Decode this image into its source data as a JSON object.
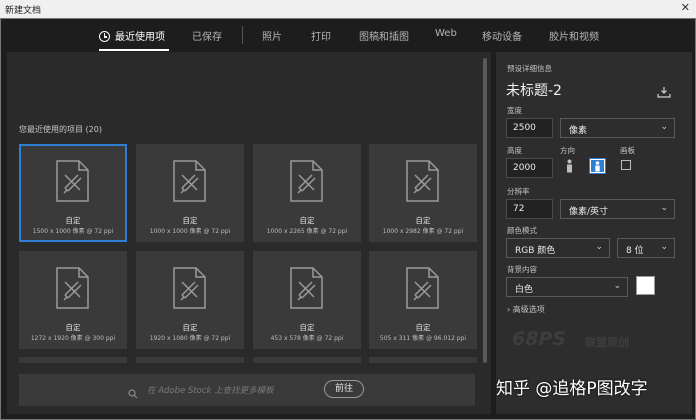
{
  "window": {
    "title": "新建文档",
    "close_glyph": "✕"
  },
  "tabs": [
    {
      "label": "最近使用项",
      "active": true
    },
    {
      "label": "已保存"
    },
    {
      "label": "照片"
    },
    {
      "label": "打印"
    },
    {
      "label": "图稿和插图"
    },
    {
      "label": "Web"
    },
    {
      "label": "移动设备"
    },
    {
      "label": "胶片和视频"
    }
  ],
  "recent": {
    "heading": "您最近使用的项目 (20)",
    "items": [
      {
        "name": "自定",
        "dims": "1500 x 1000 像素 @ 72 ppi",
        "selected": true
      },
      {
        "name": "自定",
        "dims": "1000 x 1000 像素 @ 72 ppi"
      },
      {
        "name": "自定",
        "dims": "1000 x 2265 像素 @ 72 ppi"
      },
      {
        "name": "自定",
        "dims": "1000 x 2982 像素 @ 72 ppi"
      },
      {
        "name": "自定",
        "dims": "1272 x 1920 像素 @ 300 ppi"
      },
      {
        "name": "自定",
        "dims": "1920 x 1080 像素 @ 72 ppi"
      },
      {
        "name": "自定",
        "dims": "453 x 578 像素 @ 72 ppi"
      },
      {
        "name": "自定",
        "dims": "505 x 311 像素 @ 96.012 ppi"
      }
    ]
  },
  "search": {
    "placeholder": "在 Adobe Stock 上查找更多模板",
    "go_label": "前往"
  },
  "preset": {
    "section_label": "预设详细信息",
    "name": "未标题-2",
    "width_label": "宽度",
    "width_value": "2500",
    "width_unit": "像素",
    "height_label": "高度",
    "height_value": "2000",
    "orientation_label": "方向",
    "artboard_label": "画板",
    "resolution_label": "分辨率",
    "resolution_value": "72",
    "resolution_unit": "像素/英寸",
    "color_mode_label": "颜色模式",
    "color_mode_value": "RGB 颜色",
    "bit_depth": "8 位",
    "background_label": "背景内容",
    "background_value": "白色",
    "background_color": "#ffffff",
    "advanced_label": "高级选项"
  },
  "watermarks": {
    "logo": "68PS",
    "logo_caption": "联盟原创",
    "footer": "知乎 @追格P图改字"
  },
  "colors": {
    "accent": "#2d7fd4",
    "panel": "#2a2a2a",
    "card": "#3a3a3a"
  }
}
